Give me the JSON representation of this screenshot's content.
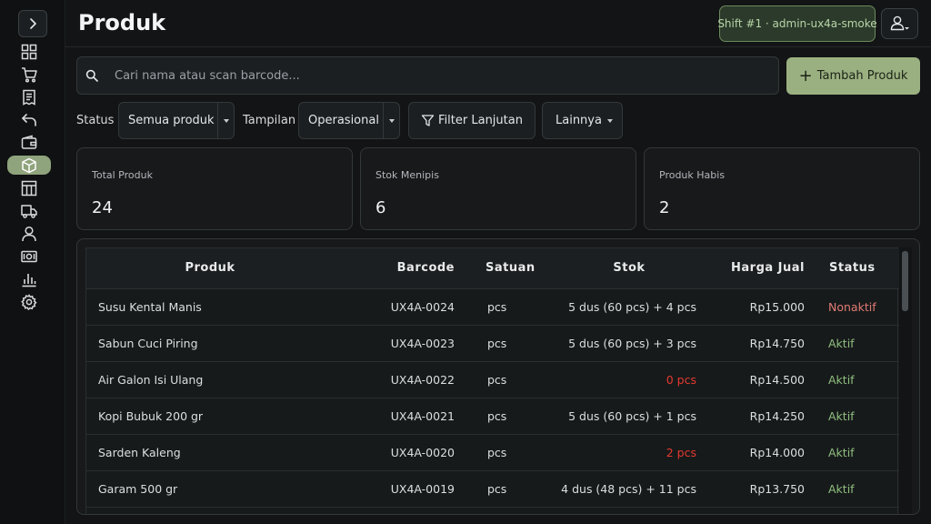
{
  "header": {
    "title": "Produk",
    "shift_badge": "Shift #1 · admin-ux4a-smoke"
  },
  "search": {
    "placeholder": "Cari nama atau scan barcode...",
    "value": ""
  },
  "actions": {
    "add_product_label": "Tambah Produk"
  },
  "filters": {
    "status_label": "Status",
    "status_value": "Semua produk",
    "view_label": "Tampilan",
    "view_value": "Operasional",
    "advanced_label": "Filter Lanjutan",
    "more_label": "Lainnya"
  },
  "stats": [
    {
      "label": "Total Produk",
      "value": "24"
    },
    {
      "label": "Stok Menipis",
      "value": "6"
    },
    {
      "label": "Produk Habis",
      "value": "2"
    }
  ],
  "table": {
    "columns": [
      "Produk",
      "Barcode",
      "Satuan",
      "Stok",
      "Harga Jual",
      "Status"
    ],
    "rows": [
      {
        "name": "Susu Kental Manis",
        "barcode": "UX4A-0024",
        "unit": "pcs",
        "stock": "5 dus (60 pcs) + 4 pcs",
        "stock_alert": false,
        "price": "Rp15.000",
        "status": "Nonaktif",
        "active": false
      },
      {
        "name": "Sabun Cuci Piring",
        "barcode": "UX4A-0023",
        "unit": "pcs",
        "stock": "5 dus (60 pcs) + 3 pcs",
        "stock_alert": false,
        "price": "Rp14.750",
        "status": "Aktif",
        "active": true
      },
      {
        "name": "Air Galon Isi Ulang",
        "barcode": "UX4A-0022",
        "unit": "pcs",
        "stock": "0 pcs",
        "stock_alert": true,
        "price": "Rp14.500",
        "status": "Aktif",
        "active": true
      },
      {
        "name": "Kopi Bubuk 200 gr",
        "barcode": "UX4A-0021",
        "unit": "pcs",
        "stock": "5 dus (60 pcs) + 1 pcs",
        "stock_alert": false,
        "price": "Rp14.250",
        "status": "Aktif",
        "active": true
      },
      {
        "name": "Sarden Kaleng",
        "barcode": "UX4A-0020",
        "unit": "pcs",
        "stock": "2 pcs",
        "stock_alert": true,
        "price": "Rp14.000",
        "status": "Aktif",
        "active": true
      },
      {
        "name": "Garam 500 gr",
        "barcode": "UX4A-0019",
        "unit": "pcs",
        "stock": "4 dus (48 pcs) + 11 pcs",
        "stock_alert": false,
        "price": "Rp13.750",
        "status": "Aktif",
        "active": true
      }
    ]
  },
  "sidebar": {
    "items": [
      {
        "icon": "dashboard-grid-icon"
      },
      {
        "icon": "cart-icon"
      },
      {
        "icon": "receipt-icon"
      },
      {
        "icon": "return-arrow-icon"
      },
      {
        "icon": "wallet-icon"
      },
      {
        "icon": "box-icon",
        "active": true
      },
      {
        "icon": "table-icon"
      },
      {
        "icon": "truck-icon"
      },
      {
        "icon": "person-icon"
      },
      {
        "icon": "cash-icon"
      },
      {
        "icon": "bar-chart-icon"
      },
      {
        "icon": "gear-icon"
      }
    ]
  },
  "colors": {
    "accent": "#9bb081",
    "status_active": "#8fbf7f",
    "status_inactive": "#e07b74",
    "stock_alert": "#e5392f"
  }
}
